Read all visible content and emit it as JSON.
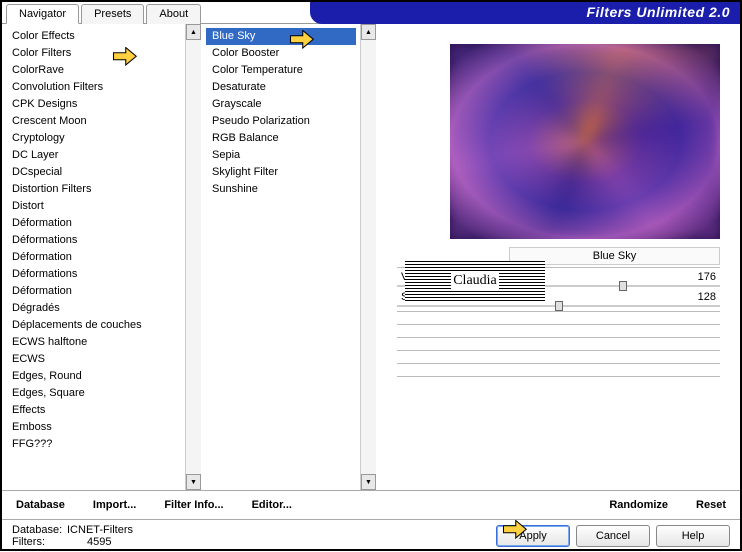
{
  "app_title": "Filters Unlimited 2.0",
  "tabs": [
    "Navigator",
    "Presets",
    "About"
  ],
  "active_tab": 0,
  "categories": [
    "Color Effects",
    "Color Filters",
    "ColorRave",
    "Convolution Filters",
    "CPK Designs",
    "Crescent Moon",
    "Cryptology",
    "DC Layer",
    "DCspecial",
    "Distortion Filters",
    "Distort",
    "Déformation",
    "Déformations",
    "Déformation",
    "Déformations",
    "Déformation",
    "Dégradés",
    "Déplacements de couches",
    "ECWS halftone",
    "ECWS",
    "Edges, Round",
    "Edges, Square",
    "Effects",
    "Emboss",
    "FFG???"
  ],
  "selected_category_index": 1,
  "filters": [
    "Blue Sky",
    "Color Booster",
    "Color Temperature",
    "Desaturate",
    "Grayscale",
    "Pseudo Polarization",
    "RGB Balance",
    "Sepia",
    "Skylight Filter",
    "Sunshine"
  ],
  "selected_filter_index": 0,
  "param_title": "Blue Sky",
  "params": [
    {
      "label": "Vertical Offset",
      "value": "176",
      "pos": 70
    },
    {
      "label": "Scale",
      "value": "128",
      "pos": 50
    }
  ],
  "toolbar": {
    "database": "Database",
    "import": "Import...",
    "filter_info": "Filter Info...",
    "editor": "Editor...",
    "randomize": "Randomize",
    "reset": "Reset"
  },
  "status": {
    "db_label": "Database:",
    "db_value": "ICNET-Filters",
    "filters_label": "Filters:",
    "filters_value": "4595"
  },
  "buttons": {
    "apply": "Apply",
    "cancel": "Cancel",
    "help": "Help"
  },
  "watermark": "Claudia"
}
